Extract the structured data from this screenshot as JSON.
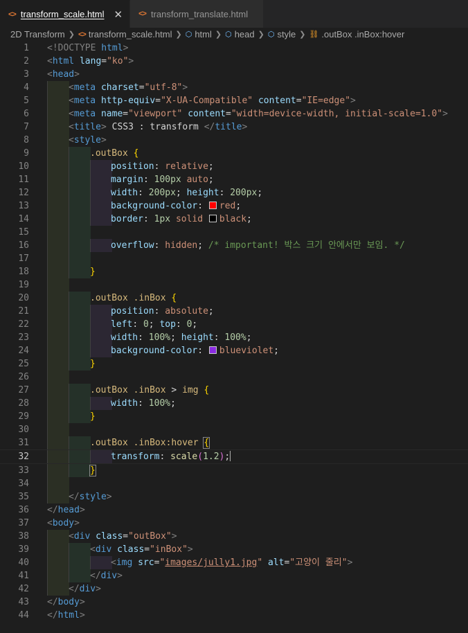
{
  "tabs": [
    {
      "label": "transform_scale.html",
      "icon": "html-icon",
      "active": true
    },
    {
      "label": "transform_translate.html",
      "icon": "html-icon",
      "active": false
    }
  ],
  "breadcrumb": [
    "2D Transform",
    "transform_scale.html",
    "html",
    "head",
    "style",
    ".outBox .inBox:hover"
  ],
  "colors": {
    "red": "#ff0000",
    "black": "#000000",
    "blueviolet": "#8a2be2"
  },
  "lines": {
    "l1": [
      "<!DOCTYPE ",
      "html",
      ">"
    ],
    "l2": [
      "<",
      "html",
      " ",
      "lang",
      "=",
      "\"ko\"",
      ">"
    ],
    "l3": [
      "<",
      "head",
      ">"
    ],
    "l4": [
      "<",
      "meta",
      " ",
      "charset",
      "=",
      "\"utf-8\"",
      ">"
    ],
    "l5": [
      "<",
      "meta",
      " ",
      "http-equiv",
      "=",
      "\"X-UA-Compatible\"",
      " ",
      "content",
      "=",
      "\"IE=edge\"",
      ">"
    ],
    "l6": [
      "<",
      "meta",
      " ",
      "name",
      "=",
      "\"viewport\"",
      " ",
      "content",
      "=",
      "\"width=device-width, initial-scale=1.0\"",
      ">"
    ],
    "l7": [
      "<",
      "title",
      ">",
      " CSS3 : transform ",
      "</",
      "title",
      ">"
    ],
    "l8": [
      "<",
      "style",
      ">"
    ],
    "l9": [
      ".outBox",
      " ",
      "{"
    ],
    "l10": [
      "position",
      ": ",
      "relative",
      ";"
    ],
    "l11": [
      "margin",
      ": ",
      "100px",
      " ",
      "auto",
      ";"
    ],
    "l12": [
      "width",
      ": ",
      "200px",
      "; ",
      "height",
      ": ",
      "200px",
      ";"
    ],
    "l13": [
      "background-color",
      ": ",
      "red",
      ";"
    ],
    "l14": [
      "border",
      ": ",
      "1px",
      " ",
      "solid",
      " ",
      "black",
      ";"
    ],
    "l16": [
      "overflow",
      ": ",
      "hidden",
      "; ",
      "/* important! 박스 크기 안에서만 보임. */"
    ],
    "l18": [
      "}"
    ],
    "l20": [
      ".outBox",
      " ",
      ".inBox",
      " ",
      "{"
    ],
    "l21": [
      "position",
      ": ",
      "absolute",
      ";"
    ],
    "l22": [
      "left",
      ": ",
      "0",
      "; ",
      "top",
      ": ",
      "0",
      ";"
    ],
    "l23": [
      "width",
      ": ",
      "100%",
      "; ",
      "height",
      ": ",
      "100%",
      ";"
    ],
    "l24": [
      "background-color",
      ": ",
      "blueviolet",
      ";"
    ],
    "l25": [
      "}"
    ],
    "l27": [
      ".outBox",
      " ",
      ".inBox",
      " > ",
      "img",
      " ",
      "{"
    ],
    "l28": [
      "width",
      ": ",
      "100%",
      ";"
    ],
    "l29": [
      "}"
    ],
    "l31": [
      ".outBox",
      " ",
      ".inBox:hover",
      " ",
      "{"
    ],
    "l32": [
      "transform",
      ": ",
      "scale",
      "(",
      "1.2",
      ")",
      ";"
    ],
    "l33": [
      "}"
    ],
    "l35": [
      "</",
      "style",
      ">"
    ],
    "l36": [
      "</",
      "head",
      ">"
    ],
    "l37": [
      "<",
      "body",
      ">"
    ],
    "l38": [
      "<",
      "div",
      " ",
      "class",
      "=",
      "\"outBox\"",
      ">"
    ],
    "l39": [
      "<",
      "div",
      " ",
      "class",
      "=",
      "\"inBox\"",
      ">"
    ],
    "l40": [
      "<",
      "img",
      " ",
      "src",
      "=",
      "\"",
      "images/jully1.jpg",
      "\"",
      " ",
      "alt",
      "=",
      "\"고양이 줄리\"",
      ">"
    ],
    "l41": [
      "</",
      "div",
      ">"
    ],
    "l42": [
      "</",
      "div",
      ">"
    ],
    "l43": [
      "</",
      "body",
      ">"
    ],
    "l44": [
      "</",
      "html",
      ">"
    ]
  },
  "line_numbers": [
    "1",
    "2",
    "3",
    "4",
    "5",
    "6",
    "7",
    "8",
    "9",
    "10",
    "11",
    "12",
    "13",
    "14",
    "15",
    "16",
    "17",
    "18",
    "19",
    "20",
    "21",
    "22",
    "23",
    "24",
    "25",
    "26",
    "27",
    "28",
    "29",
    "30",
    "31",
    "32",
    "33",
    "34",
    "35",
    "36",
    "37",
    "38",
    "39",
    "40",
    "41",
    "42",
    "43",
    "44"
  ],
  "current_line": "32"
}
